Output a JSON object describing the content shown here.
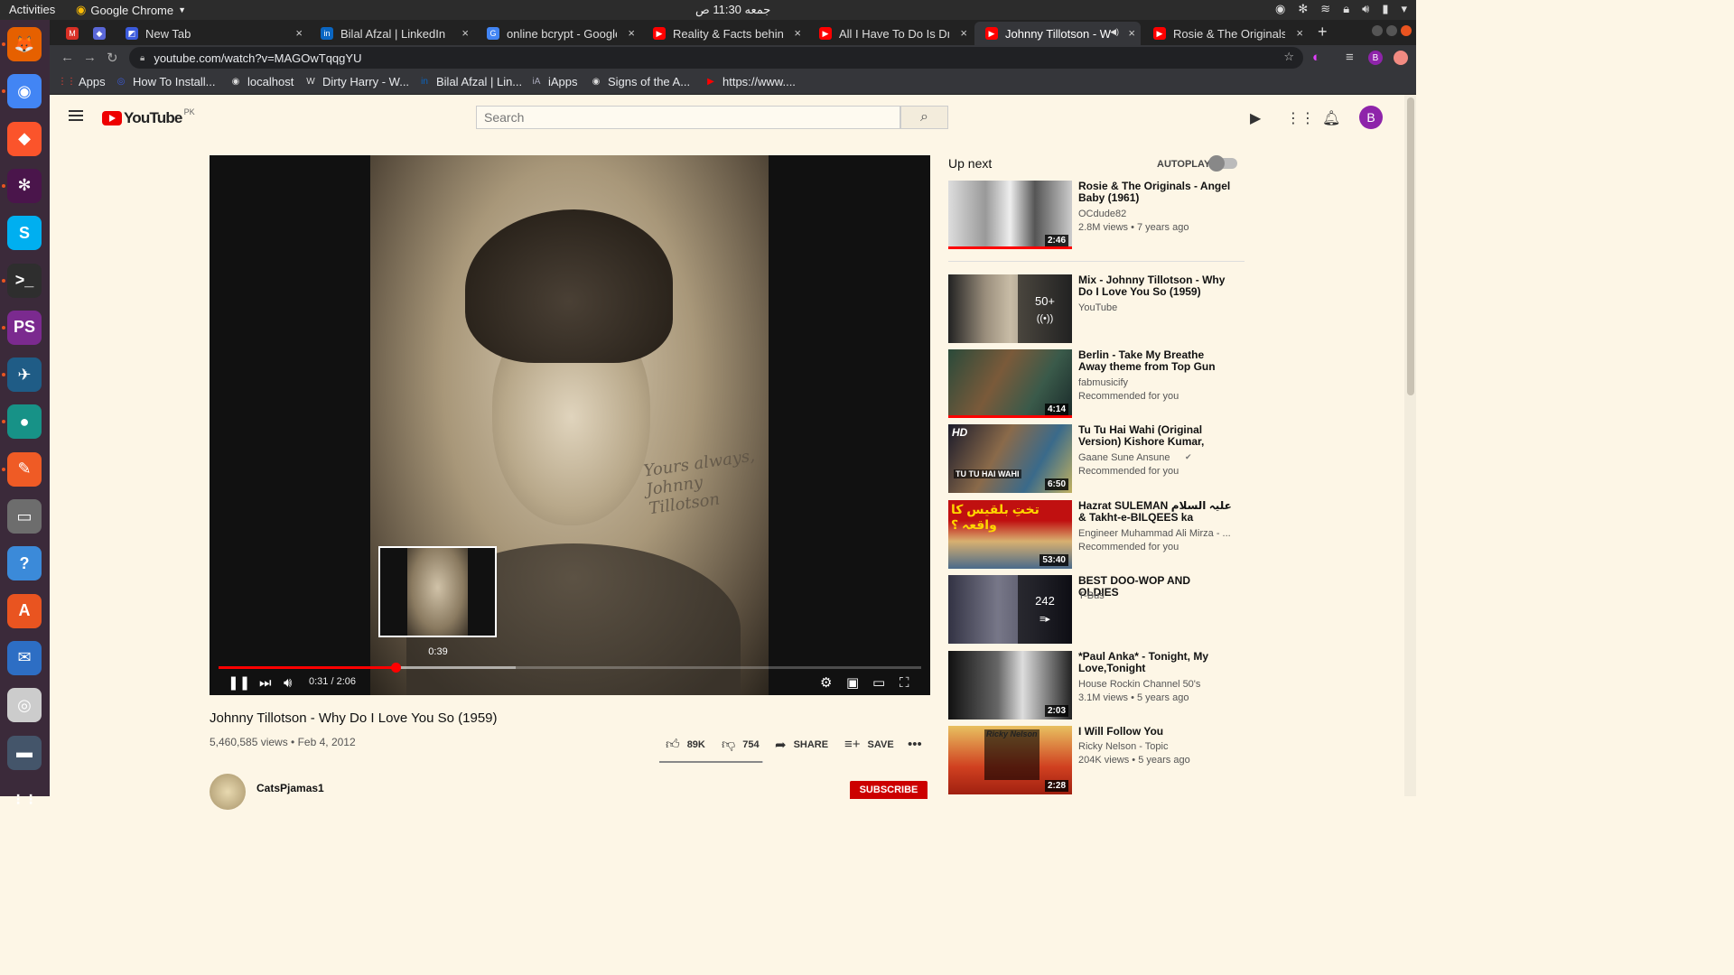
{
  "os": {
    "activities": "Activities",
    "app_name": "Google Chrome",
    "clock": "جمعه 11:30 ص"
  },
  "dock": [
    {
      "name": "firefox",
      "color": "#e66000",
      "glyph": "🦊"
    },
    {
      "name": "chrome",
      "color": "#4285f4",
      "glyph": "◉"
    },
    {
      "name": "brave",
      "color": "#fb542b",
      "glyph": "◆"
    },
    {
      "name": "slack",
      "color": "#4a154b",
      "glyph": "✻"
    },
    {
      "name": "skype",
      "color": "#00aff0",
      "glyph": "S"
    },
    {
      "name": "terminal",
      "color": "#2e2e2e",
      "glyph": ">_"
    },
    {
      "name": "phpstorm",
      "color": "#7b2a8f",
      "glyph": "PS"
    },
    {
      "name": "mysql-workbench",
      "color": "#1f5c86",
      "glyph": "✈"
    },
    {
      "name": "gitkraken",
      "color": "#179287",
      "glyph": "●"
    },
    {
      "name": "postman",
      "color": "#ef5b25",
      "glyph": "✎"
    },
    {
      "name": "files",
      "color": "#6d6d6d",
      "glyph": "▭"
    },
    {
      "name": "help",
      "color": "#3b8ad9",
      "glyph": "?"
    },
    {
      "name": "software",
      "color": "#e95420",
      "glyph": "A"
    },
    {
      "name": "thunderbird",
      "color": "#2d6ec4",
      "glyph": "✉"
    },
    {
      "name": "rhythmbox",
      "color": "#cccccc",
      "glyph": "◎"
    },
    {
      "name": "screen",
      "color": "#44556a",
      "glyph": "▬"
    },
    {
      "name": "show-apps",
      "color": "transparent",
      "glyph": "⋮⋮"
    }
  ],
  "tabs": [
    {
      "title": "",
      "favicon": "M",
      "favcolor": "#d93025"
    },
    {
      "title": "",
      "favicon": "◆",
      "favcolor": "#5a67d8"
    },
    {
      "title": "New Tab",
      "favicon": "◩",
      "favcolor": "#3b5bdb"
    },
    {
      "title": "Bilal Afzal | LinkedIn",
      "favicon": "in",
      "favcolor": "#0a66c2"
    },
    {
      "title": "online bcrypt - Google S",
      "favicon": "G",
      "favcolor": "#4285f4"
    },
    {
      "title": "Reality & Facts behind F",
      "favicon": "▶",
      "favcolor": "#ff0000"
    },
    {
      "title": "All I Have To Do Is Drean",
      "favicon": "▶",
      "favcolor": "#ff0000"
    },
    {
      "title": "Johnny Tillotson - W",
      "favicon": "▶",
      "favcolor": "#ff0000"
    },
    {
      "title": "Rosie & The Originals - A",
      "favicon": "▶",
      "favcolor": "#ff0000"
    }
  ],
  "address": {
    "url": "youtube.com/watch?v=MAGOwTqqgYU"
  },
  "bookmarks": [
    {
      "label": "Apps",
      "icon": "⋮⋮"
    },
    {
      "label": "How To Install...",
      "icon": "◎"
    },
    {
      "label": "localhost",
      "icon": "◉"
    },
    {
      "label": "Dirty Harry - W...",
      "icon": "W"
    },
    {
      "label": "Bilal Afzal | Lin...",
      "icon": "in"
    },
    {
      "label": "iApps",
      "icon": "iA"
    },
    {
      "label": "Signs of the A...",
      "icon": "◉"
    },
    {
      "label": "https://www....",
      "icon": "▶"
    }
  ],
  "youtube": {
    "logo": "YouTube",
    "country": "PK",
    "search_placeholder": "Search",
    "avatar_letter": "B"
  },
  "player": {
    "preview_time": "0:39",
    "time": "0:31 / 2:06",
    "played_fraction": 0.2516,
    "buffered_fraction": 0.4223,
    "signature": "Yours always, Johnny Tillotson"
  },
  "video": {
    "title": "Johnny Tillotson - Why Do I Love You So (1959)",
    "views": "5,460,585 views • Feb 4, 2012",
    "likes": "89K",
    "dislikes": "754",
    "like_fraction": 0.992,
    "share": "SHARE",
    "save": "SAVE",
    "channel": "CatsPjamas1",
    "subscribe": "SUBSCRIBE"
  },
  "sidebar": {
    "upnext": "Up next",
    "autoplay": "AUTOPLAY",
    "items": [
      {
        "title": "Rosie & The Originals - Angel Baby (1961)",
        "channel": "OCdude82",
        "stats": "2.8M views • 7 years ago",
        "duration": "2:46"
      },
      {
        "title": "Mix - Johnny Tillotson - Why Do I Love You So (1959)",
        "channel": "YouTube",
        "stats": "",
        "count": "50+"
      },
      {
        "title": "Berlin - Take My Breathe Away theme from Top Gun with Lyrics",
        "channel": "fabmusicify",
        "stats": "Recommended for you",
        "duration": "4:14"
      },
      {
        "title": "Tu Tu Hai Wahi (Original Version) Kishore Kumar, Asha...",
        "channel": "Gaane Sune Ansune",
        "stats": "Recommended for you",
        "duration": "6:50",
        "badge": "HD",
        "overlay_text": "TU TU HAI WAHI"
      },
      {
        "title": "Hazrat SULEMAN علیہ السلام & Takht-e-BILQEES ka Complete...",
        "channel": "Engineer Muhammad Ali Mirza - ...",
        "stats": "Recommended for you",
        "duration": "53:40",
        "overlay_text": "تختِ بلقیس کا واقعہ ؟"
      },
      {
        "title": "BEST DOO-WOP AND OLDIES",
        "channel": "T-Bus",
        "stats": "",
        "count": "242"
      },
      {
        "title": "*Paul Anka* - Tonight, My Love,Tonight",
        "channel": "House Rockin Channel 50's",
        "stats": "3.1M views • 5 years ago",
        "duration": "2:03"
      },
      {
        "title": "I Will Follow You",
        "channel": "Ricky Nelson - Topic",
        "stats": "204K views • 5 years ago",
        "duration": "2:28",
        "overlay_text": "Ricky Nelson"
      }
    ]
  },
  "colors": {
    "page_bg": "#fdf6e6",
    "accent_red": "#ff0000",
    "subscribe_red": "#cc0000"
  }
}
